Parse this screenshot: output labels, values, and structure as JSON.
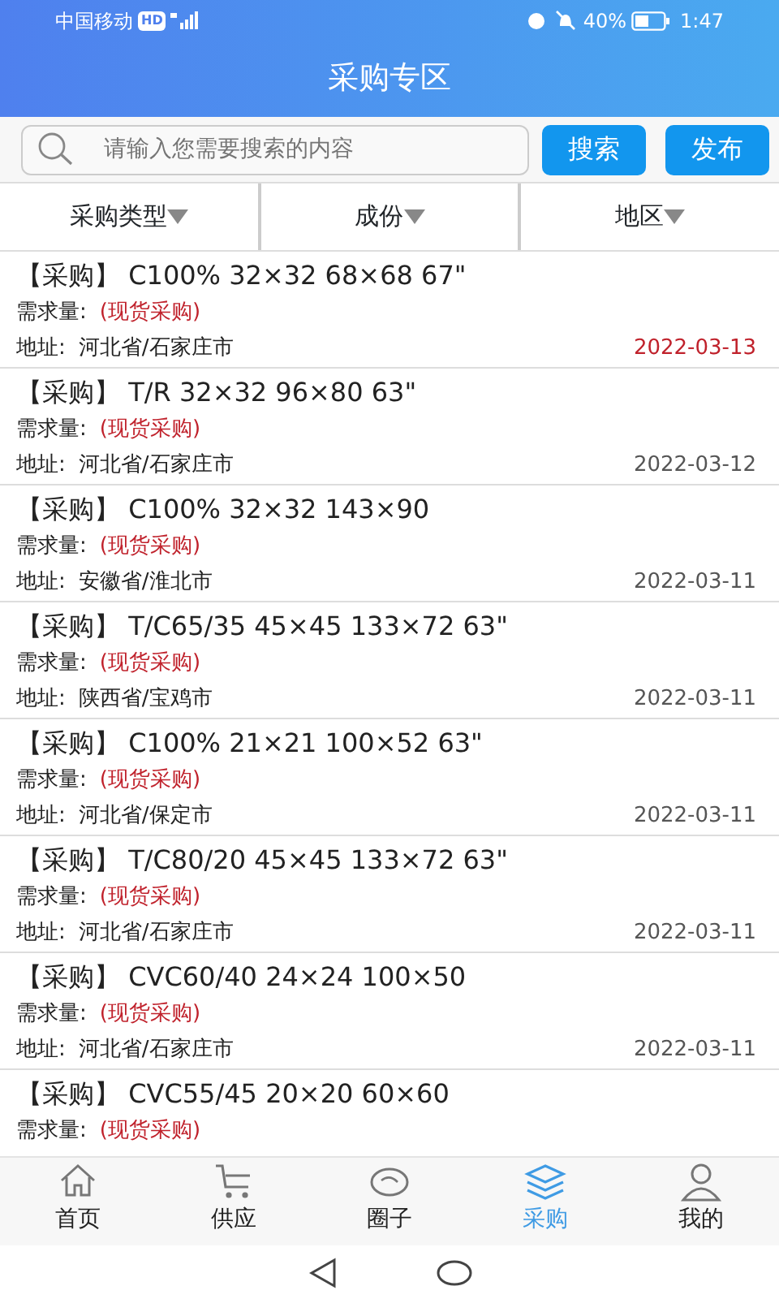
{
  "status_bar": {
    "carrier": "中国移动",
    "hd": "HD",
    "battery": "40%",
    "time": "1:47"
  },
  "header": {
    "title": "采购专区"
  },
  "search": {
    "placeholder": "请输入您需要搜索的内容",
    "buttons": [
      "搜索",
      "发布"
    ]
  },
  "filters": [
    {
      "label": "采购类型"
    },
    {
      "label": "成份"
    },
    {
      "label": "地区"
    }
  ],
  "listings": [
    {
      "title": "【采购】 C100% 32×32 68×68 67\"",
      "demand_label": "需求量:",
      "demand": "(现货采购)",
      "address_label": "地址:",
      "address": "河北省/石家庄市",
      "date": "2022-03-13",
      "highlighted": true
    },
    {
      "title": "【采购】 T/R 32×32 96×80 63\"",
      "demand_label": "需求量:",
      "demand": "(现货采购)",
      "address_label": "地址:",
      "address": "河北省/石家庄市",
      "date": "2022-03-12",
      "highlighted": false
    },
    {
      "title": "【采购】 C100% 32×32 143×90",
      "demand_label": "需求量:",
      "demand": "(现货采购)",
      "address_label": "地址:",
      "address": "安徽省/淮北市",
      "date": "2022-03-11",
      "highlighted": false
    },
    {
      "title": "【采购】 T/C65/35 45×45 133×72 63\"",
      "demand_label": "需求量:",
      "demand": "(现货采购)",
      "address_label": "地址:",
      "address": "陕西省/宝鸡市",
      "date": "2022-03-11",
      "highlighted": false
    },
    {
      "title": "【采购】 C100% 21×21 100×52 63\"",
      "demand_label": "需求量:",
      "demand": "(现货采购)",
      "address_label": "地址:",
      "address": "河北省/保定市",
      "date": "2022-03-11",
      "highlighted": false
    },
    {
      "title": "【采购】 T/C80/20 45×45 133×72 63\"",
      "demand_label": "需求量:",
      "demand": "(现货采购)",
      "address_label": "地址:",
      "address": "河北省/石家庄市",
      "date": "2022-03-11",
      "highlighted": false
    },
    {
      "title": "【采购】 CVC60/40 24×24 100×50",
      "demand_label": "需求量:",
      "demand": "(现货采购)",
      "address_label": "地址:",
      "address": "河北省/石家庄市",
      "date": "2022-03-11",
      "highlighted": false
    },
    {
      "title": "【采购】 CVC55/45 20×20 60×60",
      "demand_label": "需求量:",
      "demand": "(现货采购)"
    }
  ],
  "bottom_nav": [
    {
      "label": "首页",
      "kind": "home",
      "selected": false
    },
    {
      "label": "供应",
      "kind": "cart",
      "selected": false
    },
    {
      "label": "圈子",
      "kind": "circle",
      "selected": false
    },
    {
      "label": "采购",
      "kind": "layers",
      "selected": true
    },
    {
      "label": "我的",
      "kind": "user",
      "selected": false
    }
  ]
}
